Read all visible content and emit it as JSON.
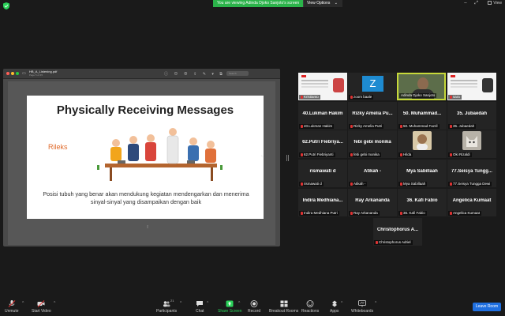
{
  "top_bar": {
    "banner": "You are viewing Adinda Djoko Sanjoto's screen",
    "view_options": "View Options",
    "view": "View"
  },
  "share": {
    "doc_name": "HB_A_Listening.pdf",
    "doc_sub": "Page 5 of 45",
    "search_placeholder": "Search",
    "page_indicator": "▯",
    "slide": {
      "title": "Physically Receiving Messages",
      "label": "Rileks",
      "body": "Posisi tubuh yang benar akan mendukung kegiatan mendengarkan dan menerima sinyal-sinyal yang disampaikan dengan baik"
    }
  },
  "gallery": {
    "video_tiles": [
      {
        "label": "Kristianto"
      },
      {
        "label": "zoom baale",
        "avatar": "Z"
      },
      {
        "label": "Adinda Djoko Sanjoto"
      },
      {
        "label": "sara"
      }
    ],
    "row2": [
      {
        "name": "40.Lukman Hakim",
        "label": "40.Lukman Hakim"
      },
      {
        "name": "Rizky Amelia Pu...",
        "label": "Rizky Amelia Putri"
      },
      {
        "name": "50. Muhammad...",
        "label": "50. Muhammad Fazril"
      },
      {
        "name": "35. Jubaedah",
        "label": "35. Jubaedah"
      }
    ],
    "row3": [
      {
        "name": "62.Putri Fiebriya...",
        "label": "62.Putri Fiebriyanti"
      },
      {
        "name": "febi gebi monika",
        "label": "febi gebi monika"
      },
      {
        "label": "Hilda"
      },
      {
        "label": "Oki Rizaldi"
      }
    ],
    "row4": [
      {
        "name": "rismawati d",
        "label": "rismawati d"
      },
      {
        "name": "Atikah -",
        "label": "Atikah -"
      },
      {
        "name": "Mya Sabillaah",
        "label": "Mya Sabillaah"
      },
      {
        "name": "77.Seisya Tungg...",
        "label": "77.Seisya Tungga Dewi"
      }
    ],
    "row5": [
      {
        "name": "Indira Medhiana...",
        "label": "Indira Medhiana Putri"
      },
      {
        "name": "Ray Arkananda",
        "label": "Ray Arkananda"
      },
      {
        "name": "36. Kafi Fabio",
        "label": "36. Kafi Fabio"
      },
      {
        "name": "Angelica Kumaat",
        "label": "Angelica Kumaat"
      }
    ],
    "row6": [
      {
        "name": "Christophorus A...",
        "label": "Christophorus Adriel"
      }
    ]
  },
  "toolbar": {
    "unmute": "Unmute",
    "start_video": "Start Video",
    "participants": "Participants",
    "participants_count": "21",
    "chat": "Chat",
    "share_screen": "Share Screen",
    "record": "Record",
    "breakout": "Breakout Rooms",
    "reactions": "Reactions",
    "apps": "Apps",
    "whiteboards": "Whiteboards",
    "leave": "Leave Room"
  },
  "colors": {
    "banner_green": "#2bb34a",
    "leave_blue": "#1f6fe0",
    "active_speaker": "#c7d93a",
    "slide_label_orange": "#e06a2a"
  }
}
